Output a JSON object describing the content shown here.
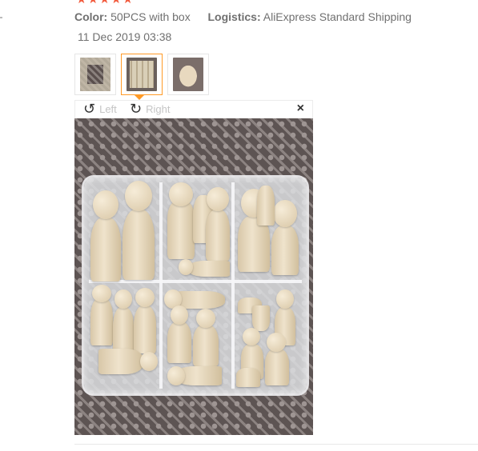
{
  "review": {
    "rating": 5,
    "color_label": "Color:",
    "color_value": "50PCS with box",
    "logistics_label": "Logistics:",
    "logistics_value": "AliExpress Standard Shipping",
    "date": "11 Dec 2019 03:38"
  },
  "thumbnails": [
    {
      "name": "thumb-1",
      "active": false
    },
    {
      "name": "thumb-2",
      "active": true
    },
    {
      "name": "thumb-3",
      "active": false
    }
  ],
  "viewer": {
    "rotate_left_label": "Left",
    "rotate_right_label": "Right",
    "close_glyph": "×",
    "rotate_left_glyph": "↺",
    "rotate_right_glyph": "↻"
  },
  "colors": {
    "star": "#f25a3c",
    "active_border": "#ff9a26"
  }
}
